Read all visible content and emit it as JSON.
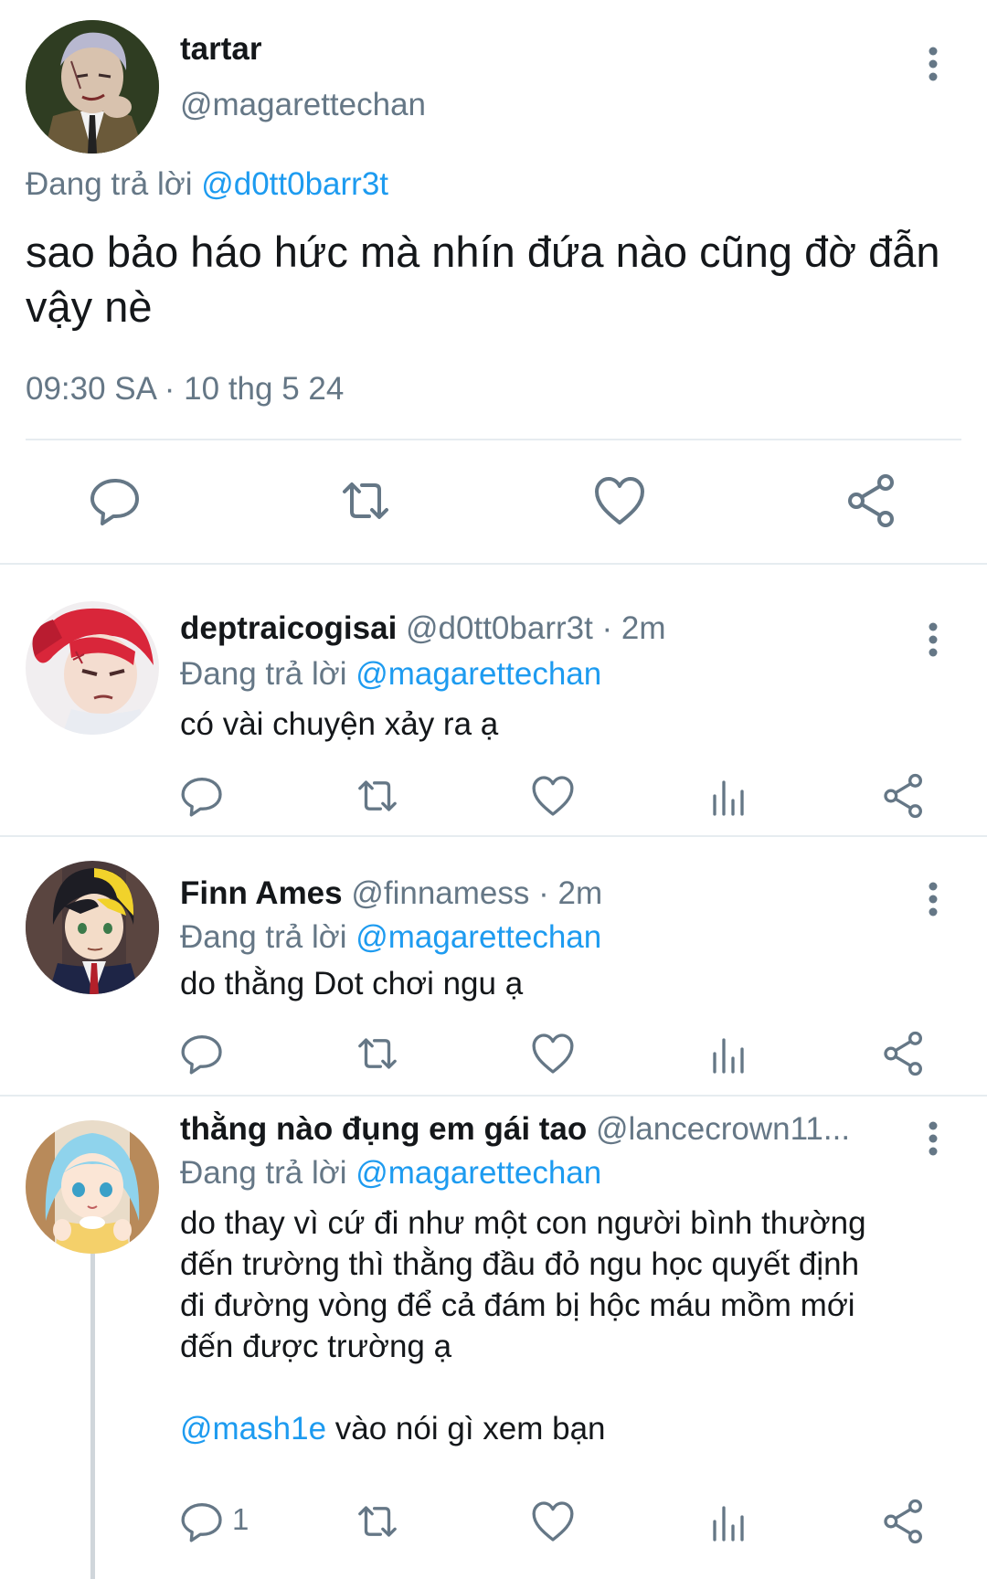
{
  "main_tweet": {
    "name": "tartar",
    "handle": "@magarettechan",
    "replying_prefix": "Đang trả lời ",
    "replying_to": "@d0tt0barr3t",
    "text": "sao bảo háo hức mà nhín đứa nào cũng đờ đẫn vậy nè",
    "timestamp": "09:30 SA · 10 thg 5 24",
    "actions": [
      "reply-icon",
      "retweet-icon",
      "like-icon",
      "share-icon"
    ]
  },
  "replies": [
    {
      "name": "deptraicogisai",
      "handle_time": " @d0tt0barr3t · 2m",
      "replying_prefix": "Đang trả lời ",
      "replying_to": "@magarettechan",
      "text": "có vài chuyện xảy ra ạ",
      "avatar_colors": {
        "hair": "#d9263a",
        "skin": "#f4ddd0",
        "shirt": "#e9ecf2"
      }
    },
    {
      "name": "Finn Ames",
      "handle_time": " @finnamess · 2m",
      "replying_prefix": "Đang trả lời ",
      "replying_to": "@magarettechan",
      "text": "do thằng Dot chơi ngu ạ",
      "avatar_colors": {
        "hair": "#1d1d24",
        "hair2": "#f1d22b",
        "skin": "#f3dcc8",
        "jacket": "#1e2546"
      }
    },
    {
      "name": "thằng nào đụng em gái tao",
      "handle_time": " @lancecrown11...",
      "replying_prefix": "Đang trả lời ",
      "replying_to": "@magarettechan",
      "text_lines": [
        "do thay vì cứ đi như một con người bình thường",
        "đến trường thì thằng đầu đỏ ngu học quyết định",
        "đi đường vòng để cả đám bị hộc máu mồm mới",
        "đến được trường ạ"
      ],
      "mention": "@mash1e",
      "mention_rest": " vào nói gì xem bạn",
      "reply_count": "1",
      "avatar_colors": {
        "hair": "#8fd3ec",
        "skin": "#fbe6d6",
        "dress": "#f4d06a"
      }
    }
  ],
  "reply_actions": [
    "reply-icon",
    "retweet-icon",
    "like-icon",
    "stats-icon",
    "share-icon"
  ],
  "colors": {
    "accent": "#1d9bf0",
    "secondary_text": "#657786",
    "icon": "#657786",
    "divider": "#e6ecf0"
  }
}
